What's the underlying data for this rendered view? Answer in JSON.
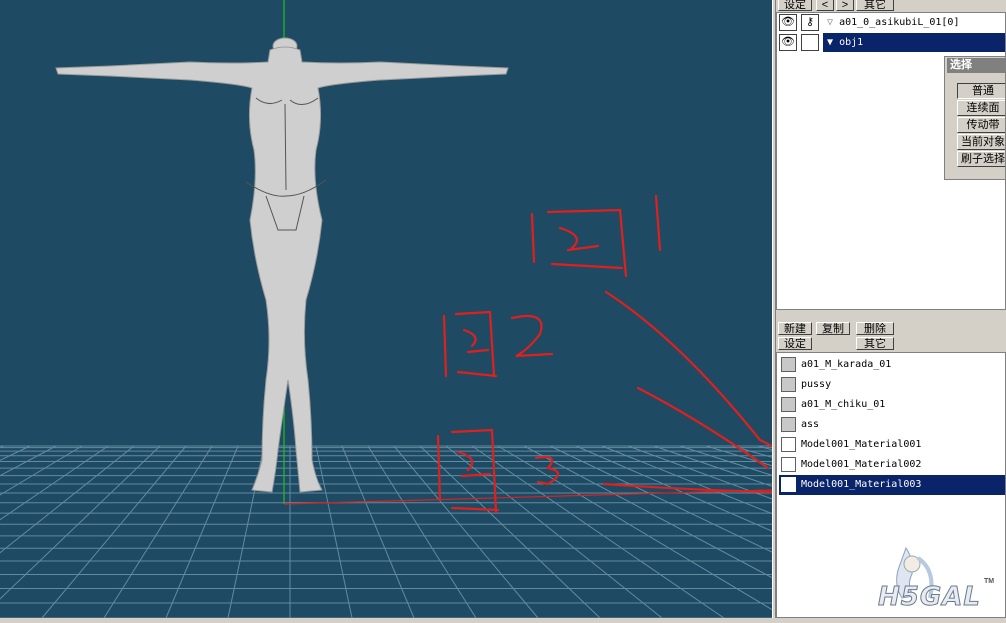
{
  "toolbar_top": {
    "settings": "设定",
    "prev": "<",
    "next": ">",
    "other": "其它"
  },
  "objects": [
    {
      "name": "a01_0_asikubiL_01[0]",
      "prefix": "▽",
      "selected": false
    },
    {
      "name": "obj1",
      "prefix": "▼",
      "selected": true
    }
  ],
  "select_panel": {
    "title": "选择",
    "buttons": [
      "普通",
      "连续面",
      "传动带",
      "当前对象",
      "刷子选择"
    ]
  },
  "material_toolbar": {
    "new": "新建",
    "copy": "复制",
    "delete": "删除",
    "settings": "设定",
    "other": "其它"
  },
  "materials": [
    {
      "name": "a01_M_karada_01",
      "swatch": "#c8c8c8",
      "selected": false
    },
    {
      "name": "pussy",
      "swatch": "#c8c8c8",
      "selected": false
    },
    {
      "name": "a01_M_chiku_01",
      "swatch": "#c8c8c8",
      "selected": false
    },
    {
      "name": "ass",
      "swatch": "#c8c8c8",
      "selected": false
    },
    {
      "name": "Model001_Material001",
      "swatch": "#ffffff",
      "selected": false
    },
    {
      "name": "Model001_Material002",
      "swatch": "#ffffff",
      "selected": false
    },
    {
      "name": "Model001_Material003",
      "swatch": "#ffffff",
      "selected": true
    }
  ],
  "annotations": [
    "图1",
    "图2",
    "图3"
  ],
  "watermark": {
    "text": "H5GAL",
    "tm": "TM"
  },
  "colors": {
    "viewport": "#1e4a64",
    "selection": "#0a246a",
    "ink": "#e0201c",
    "axis_y": "#20c020"
  }
}
